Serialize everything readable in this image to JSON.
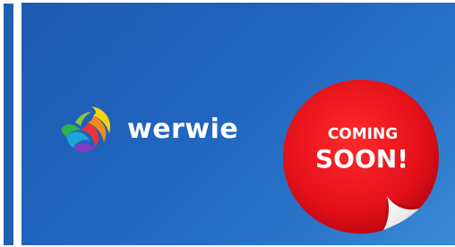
{
  "banner": {
    "brand_name": "werwie",
    "logo_icon": "swirl-globe-logo-icon",
    "sticker_line1": "COMING",
    "sticker_line2": "SOON!",
    "colors": {
      "background": "#2064bd",
      "sticker": "#e8121c",
      "text": "#ffffff"
    }
  }
}
